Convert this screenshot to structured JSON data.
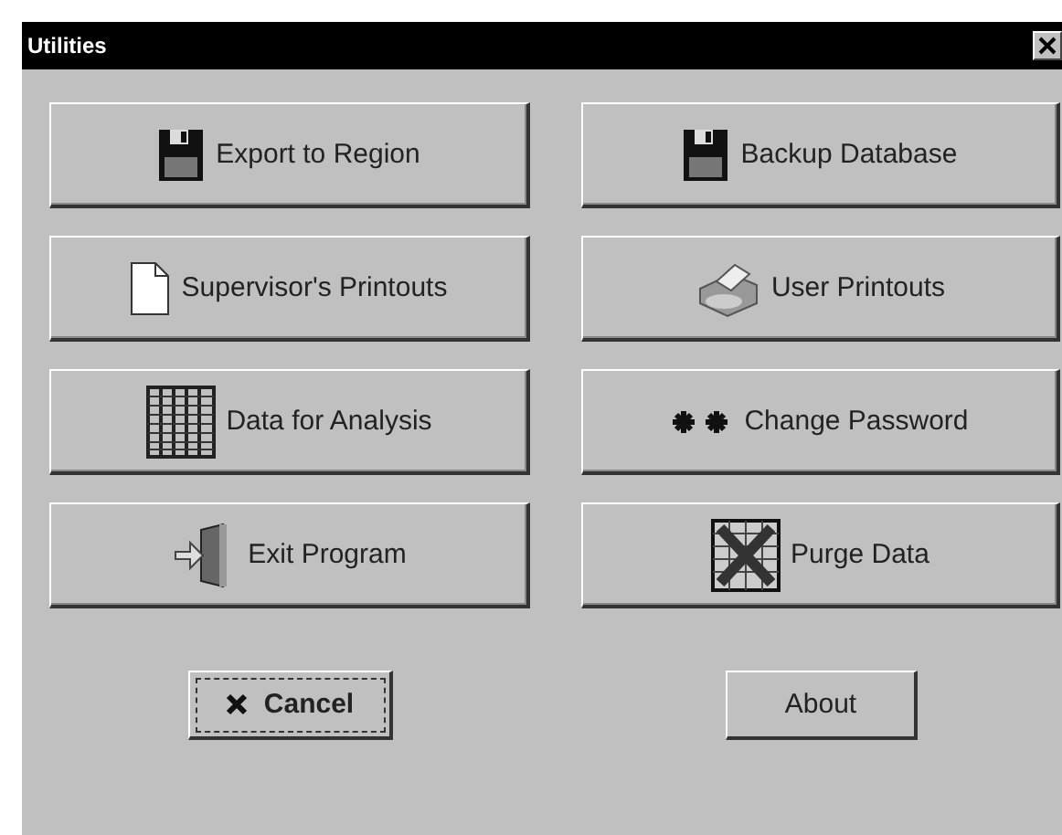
{
  "window": {
    "title": "Utilities"
  },
  "buttons": [
    {
      "label": "Export to Region"
    },
    {
      "label": "Backup Database"
    },
    {
      "label": "Supervisor's Printouts"
    },
    {
      "label": "User Printouts"
    },
    {
      "label": "Data for Analysis"
    },
    {
      "label": "Change Password"
    },
    {
      "label": "Exit Program"
    },
    {
      "label": "Purge Data"
    }
  ],
  "footer_buttons": [
    {
      "label": "Cancel",
      "focused": true
    },
    {
      "label": "About",
      "focused": false
    }
  ]
}
